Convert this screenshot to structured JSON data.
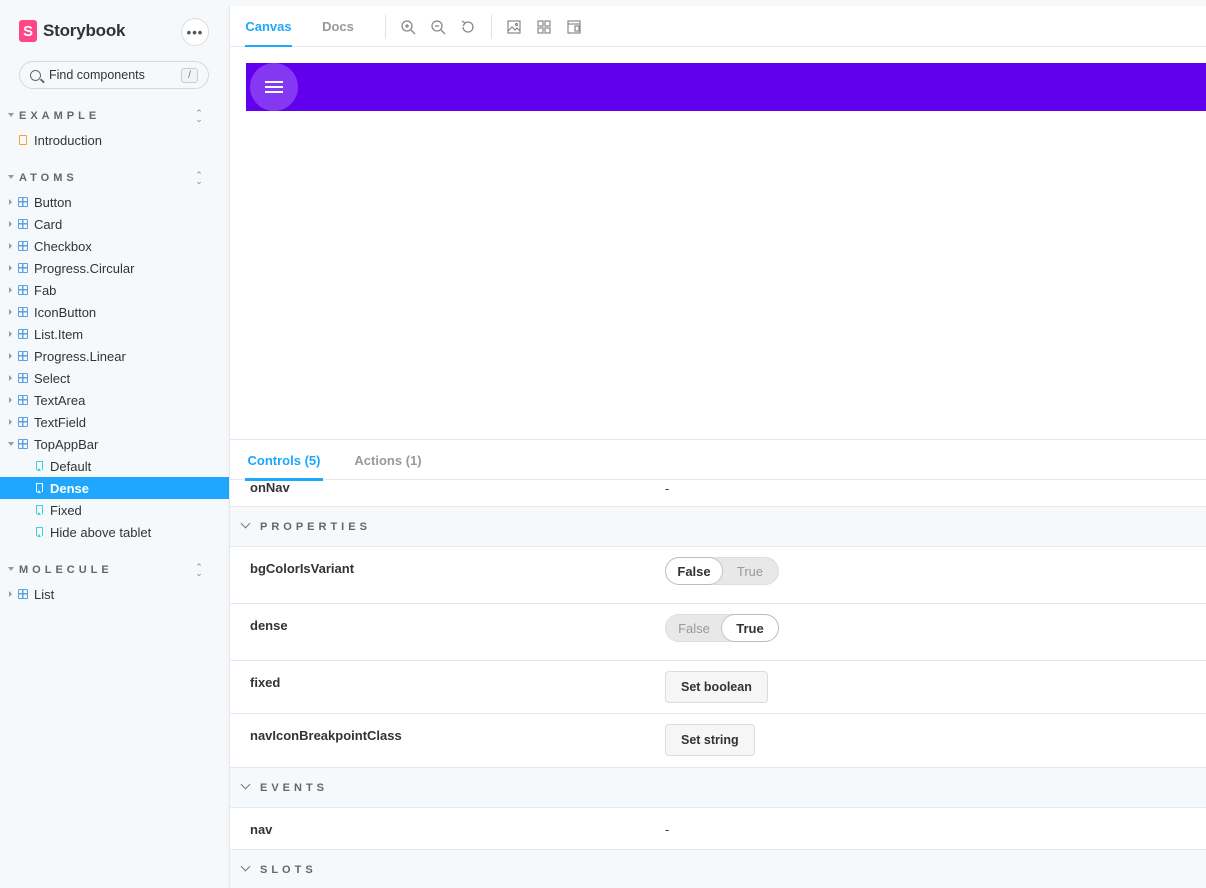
{
  "brand": {
    "name": "Storybook",
    "logo_letter": "S"
  },
  "sidebar": {
    "menu_label": "•••",
    "search": {
      "placeholder": "Find components",
      "shortcut": "/"
    },
    "sections": [
      {
        "label": "EXAMPLE",
        "items": [
          {
            "label": "Introduction"
          }
        ]
      },
      {
        "label": "ATOMS",
        "items": [
          {
            "label": "Button"
          },
          {
            "label": "Card"
          },
          {
            "label": "Checkbox"
          },
          {
            "label": "Progress.Circular"
          },
          {
            "label": "Fab"
          },
          {
            "label": "IconButton"
          },
          {
            "label": "List.Item"
          },
          {
            "label": "Progress.Linear"
          },
          {
            "label": "Select"
          },
          {
            "label": "TextArea"
          },
          {
            "label": "TextField"
          },
          {
            "label": "TopAppBar"
          }
        ],
        "stories": [
          {
            "label": "Default"
          },
          {
            "label": "Dense",
            "selected": true
          },
          {
            "label": "Fixed"
          },
          {
            "label": "Hide above tablet"
          }
        ]
      },
      {
        "label": "MOLECULE",
        "items": [
          {
            "label": "List"
          }
        ]
      }
    ]
  },
  "toolbar": {
    "tabs": [
      {
        "label": "Canvas",
        "active": true
      },
      {
        "label": "Docs"
      }
    ],
    "tools": [
      "zoom-in-icon",
      "zoom-out-icon",
      "zoom-reset-icon",
      "background-icon",
      "grid-icon",
      "viewport-icon"
    ]
  },
  "canvas": {
    "appbar_color": "#6200ee"
  },
  "addons": {
    "tabs": [
      {
        "label": "Controls (5)",
        "active": true
      },
      {
        "label": "Actions (1)"
      }
    ],
    "rows": {
      "onNav": {
        "name": "onNav",
        "value": "-"
      },
      "properties_label": "PROPERTIES",
      "bgColorIsVariant": {
        "name": "bgColorIsVariant",
        "false_label": "False",
        "true_label": "True"
      },
      "dense": {
        "name": "dense",
        "false_label": "False",
        "true_label": "True"
      },
      "fixed": {
        "name": "fixed",
        "button": "Set boolean"
      },
      "navIconBreakpointClass": {
        "name": "navIconBreakpointClass",
        "button": "Set string"
      },
      "events_label": "EVENTS",
      "nav": {
        "name": "nav",
        "value": "-"
      },
      "slots_label": "SLOTS"
    }
  },
  "colors": {
    "accent": "#1ea7fd",
    "brand": "#ff4785",
    "component": "#5ea3e0",
    "story": "#37d5d3",
    "doc": "#f5a623"
  }
}
